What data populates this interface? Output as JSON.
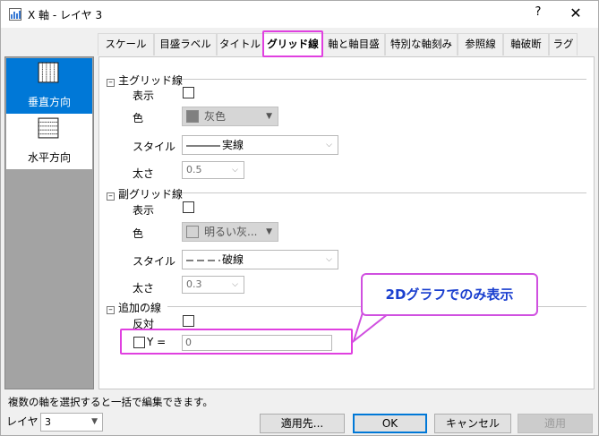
{
  "window": {
    "title": "X 軸 - レイヤ 3",
    "help": "?",
    "close": "✕"
  },
  "tabs": [
    {
      "label": "スケール",
      "active": false
    },
    {
      "label": "目盛ラベル",
      "active": false
    },
    {
      "label": "タイトル",
      "active": false
    },
    {
      "label": "グリッド線",
      "active": true
    },
    {
      "label": "軸と軸目盛",
      "active": false
    },
    {
      "label": "特別な軸刻み",
      "active": false
    },
    {
      "label": "参照線",
      "active": false
    },
    {
      "label": "軸破断",
      "active": false
    },
    {
      "label": "ラグ",
      "active": false
    }
  ],
  "sidebar": {
    "items": [
      {
        "label": "垂直方向",
        "selected": true
      },
      {
        "label": "水平方向",
        "selected": false
      }
    ]
  },
  "major_grid": {
    "heading": "主グリッド線",
    "show_label": "表示",
    "show_checked": false,
    "color_label": "色",
    "color_value": "灰色",
    "color_swatch": "#808080",
    "style_label": "スタイル",
    "style_value": "実線",
    "thickness_label": "太さ",
    "thickness_value": "0.5"
  },
  "minor_grid": {
    "heading": "副グリッド線",
    "show_label": "表示",
    "show_checked": false,
    "color_label": "色",
    "color_value": "明るい灰...",
    "color_swatch": "#d3d3d3",
    "style_label": "スタイル",
    "style_value": "破線",
    "thickness_label": "太さ",
    "thickness_value": "0.3"
  },
  "additional_lines": {
    "heading": "追加の線",
    "opposite_label": "反対",
    "opposite_checked": false,
    "y_label": "Y =",
    "y_checked": false,
    "y_value": "0"
  },
  "callout": {
    "text": "2Dグラフでのみ表示"
  },
  "status": {
    "text": "複数の軸を選択すると一括で編集できます。"
  },
  "footer": {
    "layer_label": "レイヤ",
    "layer_value": "3",
    "apply_to": "適用先...",
    "ok": "OK",
    "cancel": "キャンセル",
    "apply": "適用"
  },
  "colors": {
    "highlight": "#e040e0",
    "accent": "#0078d7",
    "callout_text": "#1a3fcf"
  }
}
